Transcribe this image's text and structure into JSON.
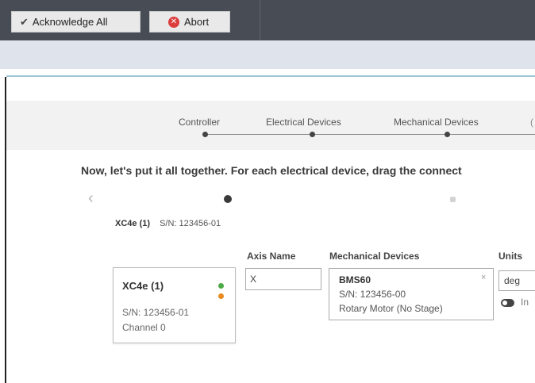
{
  "toolbar": {
    "acknowledge_label": "Acknowledge All",
    "abort_label": "Abort",
    "acknowledge_icon": "check-icon",
    "abort_icon": "abort-icon",
    "abort_color": "#dc3d3d"
  },
  "stepper": {
    "steps": [
      {
        "label": "Controller"
      },
      {
        "label": "Electrical Devices"
      },
      {
        "label": "Mechanical Devices"
      }
    ]
  },
  "instructions": "Now, let's put it all together. For each electrical device, drag the connect",
  "device": {
    "name": "XC4e (1)",
    "serial": "S/N: 123456-01"
  },
  "columns": {
    "axis_name": "Axis Name",
    "mechanical_devices": "Mechanical Devices",
    "units": "Units"
  },
  "device_card": {
    "name": "XC4e (1)",
    "serial": "S/N: 123456-01",
    "channel": "Channel 0",
    "status_colors": [
      "#4caa47",
      "#e88b1e"
    ]
  },
  "axis_input": {
    "value": "X"
  },
  "mechanical_card": {
    "name": "BMS60",
    "serial": "S/N: 123456-00",
    "type": "Rotary Motor (No Stage)",
    "close": "×"
  },
  "units": {
    "selected": "deg",
    "toggle_label": "In"
  }
}
